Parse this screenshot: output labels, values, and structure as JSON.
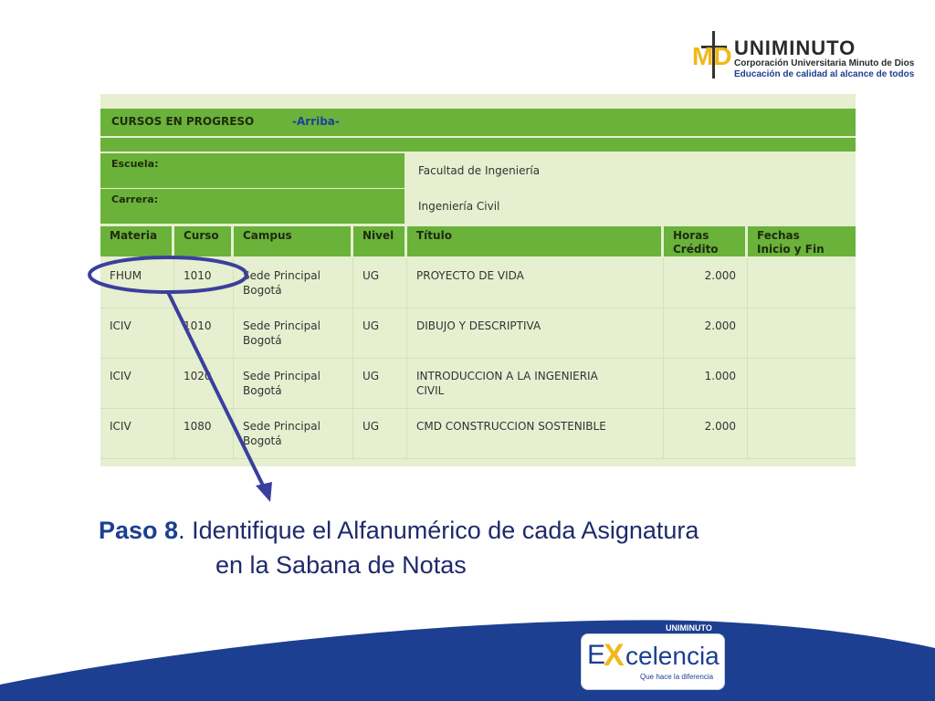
{
  "brand": {
    "monogram": "MD",
    "name": "UNIMINUTO",
    "subtitle": "Corporación Universitaria Minuto de Dios",
    "tagline": "Educación de calidad al alcance de todos"
  },
  "panel": {
    "header_title": "CURSOS EN PROGRESO",
    "header_link": "-Arriba-",
    "escuela_label": "Escuela:",
    "escuela_value": "Facultad de Ingeniería",
    "carrera_label": "Carrera:",
    "carrera_value": "Ingeniería Civil",
    "columns": [
      "Materia",
      "Curso",
      "Campus",
      "Nivel",
      "Título",
      "Horas\nCrédito",
      "Fechas\nInicio y Fin"
    ],
    "rows": [
      {
        "materia": "FHUM",
        "curso": "1010",
        "campus": "Sede Principal\nBogotá",
        "nivel": "UG",
        "titulo": "PROYECTO DE VIDA",
        "horas": "2.000",
        "fechas": ""
      },
      {
        "materia": "ICIV",
        "curso": "1010",
        "campus": "Sede Principal\nBogotá",
        "nivel": "UG",
        "titulo": "DIBUJO Y DESCRIPTIVA",
        "horas": "2.000",
        "fechas": ""
      },
      {
        "materia": "ICIV",
        "curso": "1020",
        "campus": "Sede Principal\nBogotá",
        "nivel": "UG",
        "titulo": "INTRODUCCION A LA INGENIERIA\nCIVIL",
        "horas": "1.000",
        "fechas": ""
      },
      {
        "materia": "ICIV",
        "curso": "1080",
        "campus": "Sede Principal\nBogotá",
        "nivel": "UG",
        "titulo": "CMD CONSTRUCCION SOSTENIBLE",
        "horas": "2.000",
        "fechas": ""
      }
    ]
  },
  "caption": {
    "step": "Paso 8",
    "line1_rest": ". Identifique el Alfanumérico de cada Asignatura",
    "line2": "en la Sabana de Notas"
  },
  "footer_logo": {
    "org": "UNIMINUTO",
    "e": "E",
    "x": "X",
    "rest": "celencia",
    "tagline": "Que hace la diferencia"
  },
  "colors": {
    "header_green": "#6ab23a",
    "panel_bg": "#e6efcf",
    "annotation_blue": "#3a3f9e",
    "band_blue": "#1c3f91"
  }
}
